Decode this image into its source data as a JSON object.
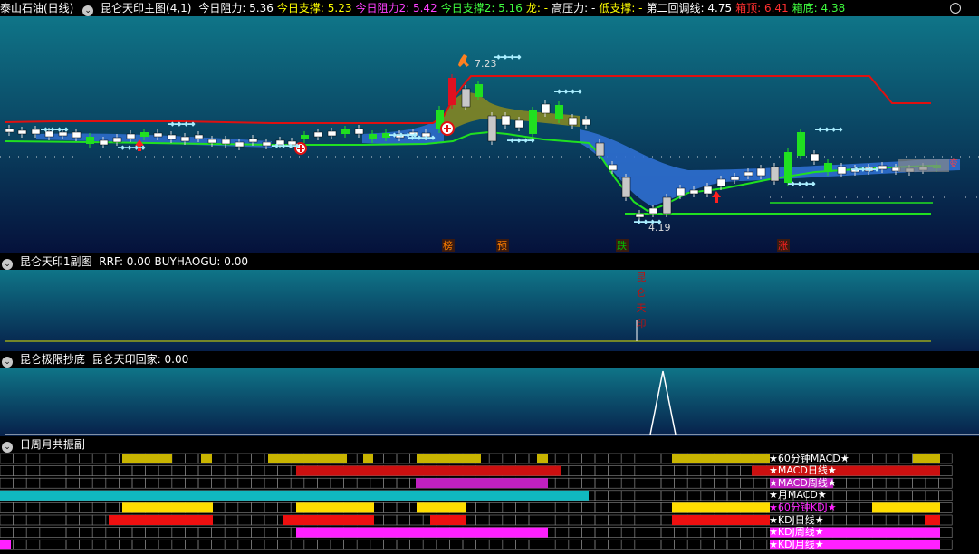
{
  "header": {
    "stock": "泰山石油(日线)",
    "indicator": "昆仑天印主图(4,1)",
    "items": [
      {
        "label": "今日阻力:",
        "value": "5.36",
        "color": "#ffffff"
      },
      {
        "label": "今日支撑:",
        "value": "5.23",
        "color": "#ffff00"
      },
      {
        "label": "今日阻力2:",
        "value": "5.42",
        "color": "#ff40ff"
      },
      {
        "label": "今日支撑2:",
        "value": "5.16",
        "color": "#40ff40"
      },
      {
        "label": "龙:",
        "value": "-",
        "color": "#ffff00"
      },
      {
        "label": "高压力:",
        "value": "-",
        "color": "#ffffff"
      },
      {
        "label": "低支撑:",
        "value": "-",
        "color": "#ffff00"
      },
      {
        "label": "第二回调线:",
        "value": "4.75",
        "color": "#ffffff"
      },
      {
        "label": "箱顶:",
        "value": "6.41",
        "color": "#ff3030"
      },
      {
        "label": "箱底:",
        "value": "4.38",
        "color": "#40ff40"
      }
    ]
  },
  "main": {
    "peak_label": "7.23",
    "trough_label": "4.19",
    "signals": [
      {
        "text": "榜",
        "color": "#ff7f00"
      },
      {
        "text": "预",
        "color": "#ff7f00"
      },
      {
        "text": "跌",
        "color": "#00c000"
      },
      {
        "text": "涨",
        "color": "#ff2020"
      }
    ]
  },
  "sub1": {
    "title": "昆仑天印1副图",
    "items": [
      {
        "label": "RRF:",
        "value": "0.00"
      },
      {
        "label": "BUYHAOGU:",
        "value": "0.00"
      }
    ],
    "vertical_text": "昆仑天印"
  },
  "sub2": {
    "title": "昆仑极限抄底",
    "items": [
      {
        "label": "昆仑天印回家:",
        "value": "0.00"
      }
    ]
  },
  "sub3": {
    "title": "日周月共振副",
    "rows": [
      {
        "label": "★60分钟MACD★",
        "color": "#c8b400"
      },
      {
        "label": "★MACD日线★",
        "color": "#cc1010"
      },
      {
        "label": "★MACD周线★",
        "color": "#c020c0"
      },
      {
        "label": "★月MACD★",
        "color": "#10b8c0"
      },
      {
        "label": "★60分钟KDJ★",
        "color": "#ffdd00"
      },
      {
        "label": "★KDJ日线★",
        "color": "#ee1010"
      },
      {
        "label": "★KDJ周线★",
        "color": "#ff20ff"
      },
      {
        "label": "★KDJ月线★",
        "color": "#ff20ff"
      }
    ]
  },
  "colors": {
    "bg_top": "#0e6d7f",
    "bg_bottom": "#06143f",
    "resist": "#e01010",
    "support": "#20e020",
    "cloud": "#2a6fd0"
  }
}
